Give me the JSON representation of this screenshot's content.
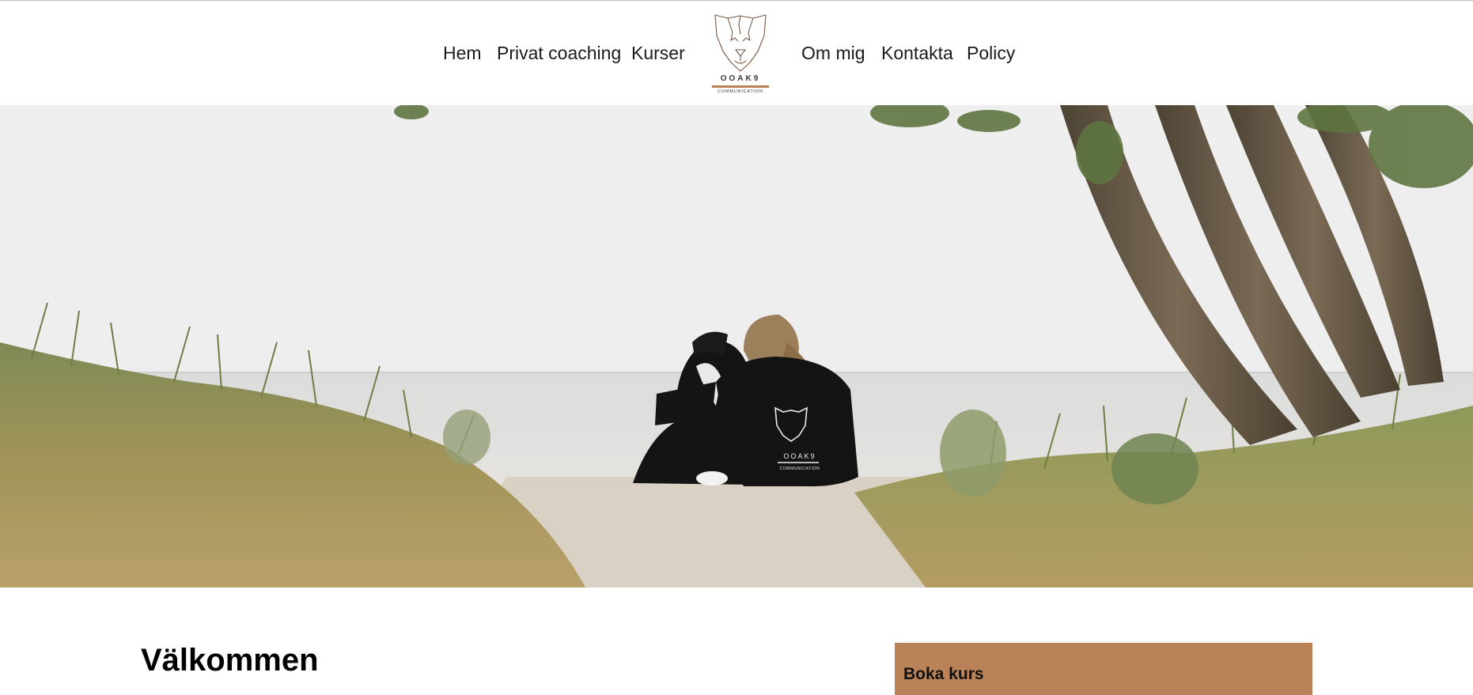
{
  "nav": {
    "left": [
      {
        "label": "Hem"
      },
      {
        "label": "Privat coaching"
      },
      {
        "label": "Kurser"
      }
    ],
    "right": [
      {
        "label": "Om mig"
      },
      {
        "label": "Kontakta"
      },
      {
        "label": "Policy"
      }
    ]
  },
  "logo": {
    "brand": "OOAK9",
    "tagline": "COMMUNICATION",
    "icon": "dog-head-icon",
    "accent": "#b98258"
  },
  "hero": {
    "image": "woman-with-dog-on-beach-photo",
    "hoodie_brand": "OOAK9",
    "hoodie_tagline": "COMMUNICATION"
  },
  "main": {
    "heading": "Välkommen"
  },
  "sidebar": {
    "booking_title": "Boka kurs",
    "booking_color": "#b98258"
  }
}
